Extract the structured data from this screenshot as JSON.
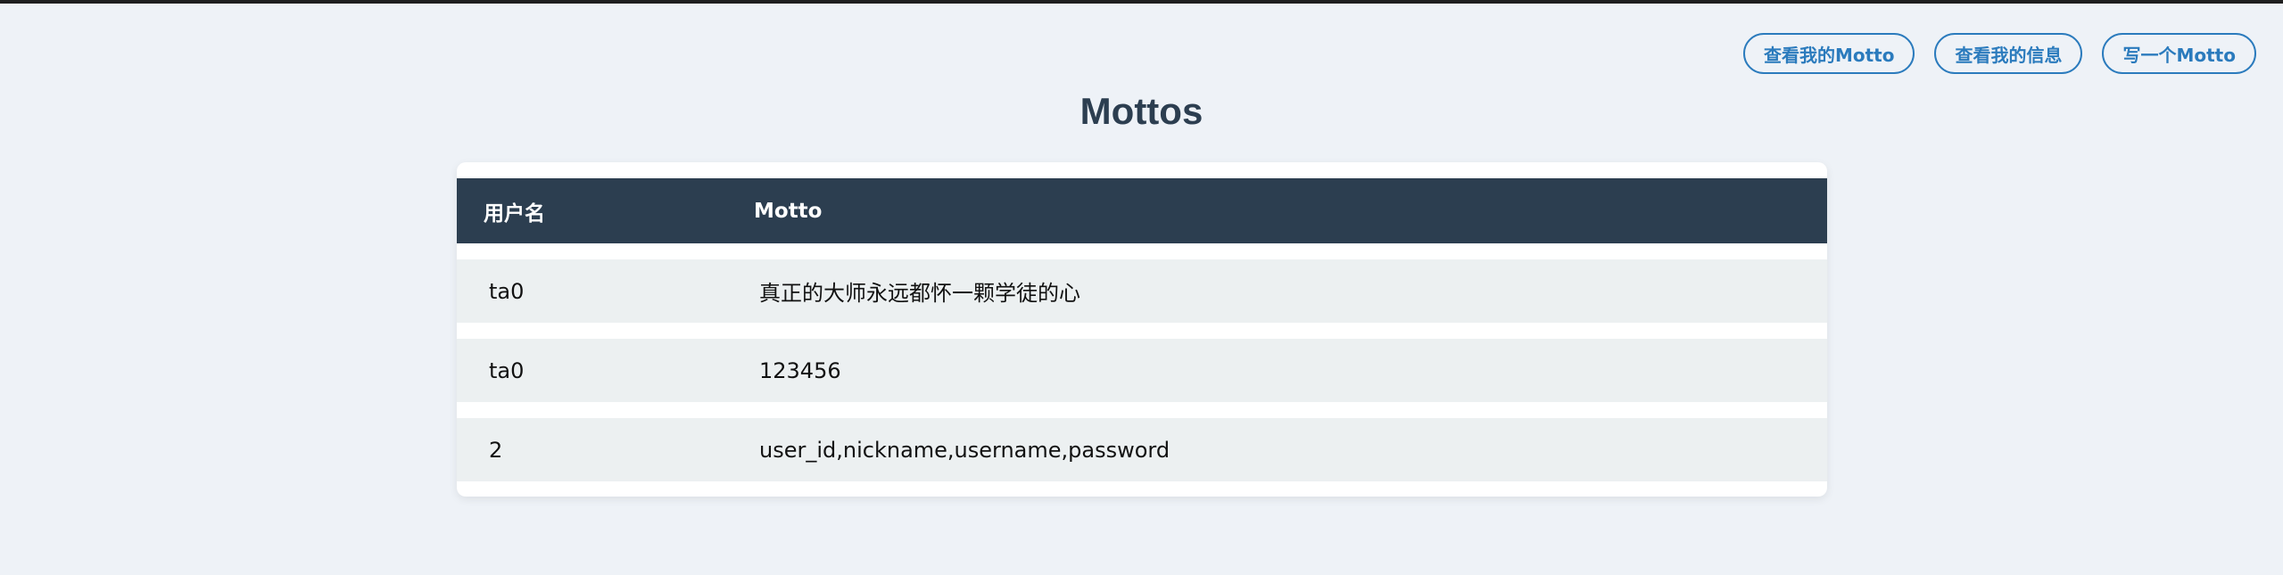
{
  "nav": {
    "buttons": [
      {
        "label": "查看我的Motto"
      },
      {
        "label": "查看我的信息"
      },
      {
        "label": "写一个Motto"
      }
    ]
  },
  "page": {
    "title": "Mottos"
  },
  "table": {
    "headers": {
      "username": "用户名",
      "motto": "Motto"
    },
    "rows": [
      {
        "username": "ta0",
        "motto": "真正的大师永远都怀一颗学徒的心"
      },
      {
        "username": "ta0",
        "motto": "123456"
      },
      {
        "username": "2",
        "motto": "user_id,nickname,username,password"
      }
    ]
  },
  "colors": {
    "background": "#eef2f7",
    "header": "#2c3e50",
    "accent": "#2b7bbd",
    "row": "#ecf0f1"
  }
}
